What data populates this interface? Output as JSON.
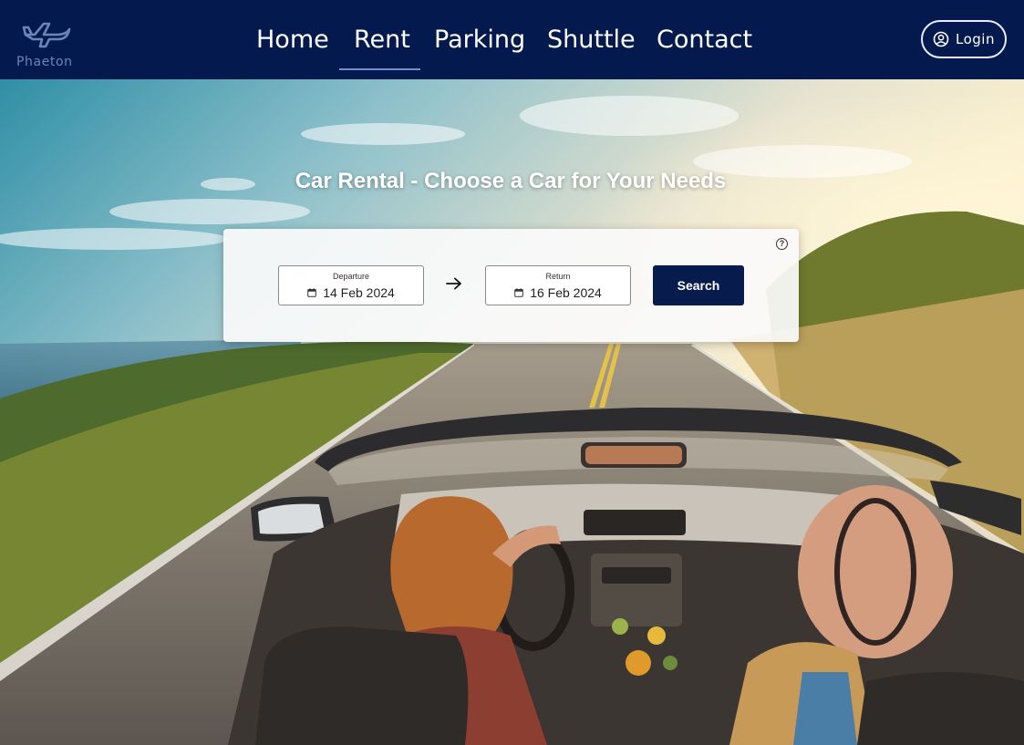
{
  "brand": {
    "name": "Phaeton",
    "logo_icon": "airplane-icon"
  },
  "nav": {
    "items": [
      {
        "label": "Home"
      },
      {
        "label": "Rent",
        "active": true
      },
      {
        "label": "Parking"
      },
      {
        "label": "Shuttle"
      },
      {
        "label": "Contact"
      }
    ]
  },
  "login": {
    "label": "Login",
    "icon": "user-circle-icon"
  },
  "hero": {
    "title": "Car Rental - Choose a Car for Your Needs",
    "image": "couple-driving-convertible-on-coastal-road"
  },
  "search": {
    "help_icon": "?",
    "departure": {
      "label": "Departure",
      "value": "14 Feb 2024",
      "icon": "calendar-icon"
    },
    "return": {
      "label": "Return",
      "value": "16 Feb 2024",
      "icon": "calendar-icon"
    },
    "arrow_icon": "arrow-right-icon",
    "button_label": "Search"
  },
  "colors": {
    "header_bg": "#041a4e",
    "accent": "#071c4d",
    "nav_underline": "#6f8fc9"
  }
}
